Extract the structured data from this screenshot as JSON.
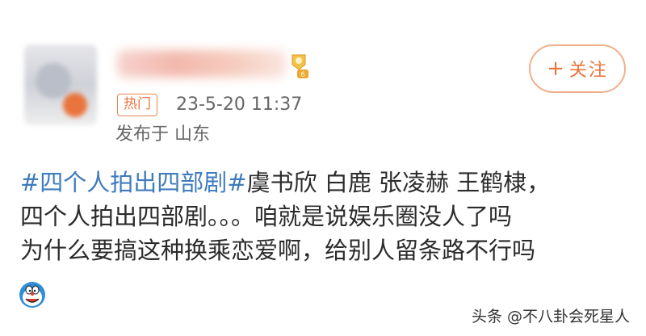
{
  "header": {
    "follow_label": "关注",
    "follow_plus": "+",
    "hot_label": "热门",
    "timestamp": "23-5-20 11:37",
    "location": "发布于 山东",
    "level_text": "6"
  },
  "post": {
    "hashtag": "#四个人拍出四部剧#",
    "line1_rest": "虞书欣 白鹿 张凌赫 王鹤棣，",
    "line2": "四个人拍出四部剧。。。咱就是说娱乐圈没人了吗",
    "line3": "为什么要搞这种换乘恋爱啊，给别人留条路不行吗"
  },
  "watermark": "头条 @不八卦会死星人",
  "colors": {
    "accent": "#e9743c",
    "hashtag": "#3f7bbd"
  },
  "icons": {
    "emoji": "doraemon-face-icon",
    "level": "level-badge-icon"
  }
}
